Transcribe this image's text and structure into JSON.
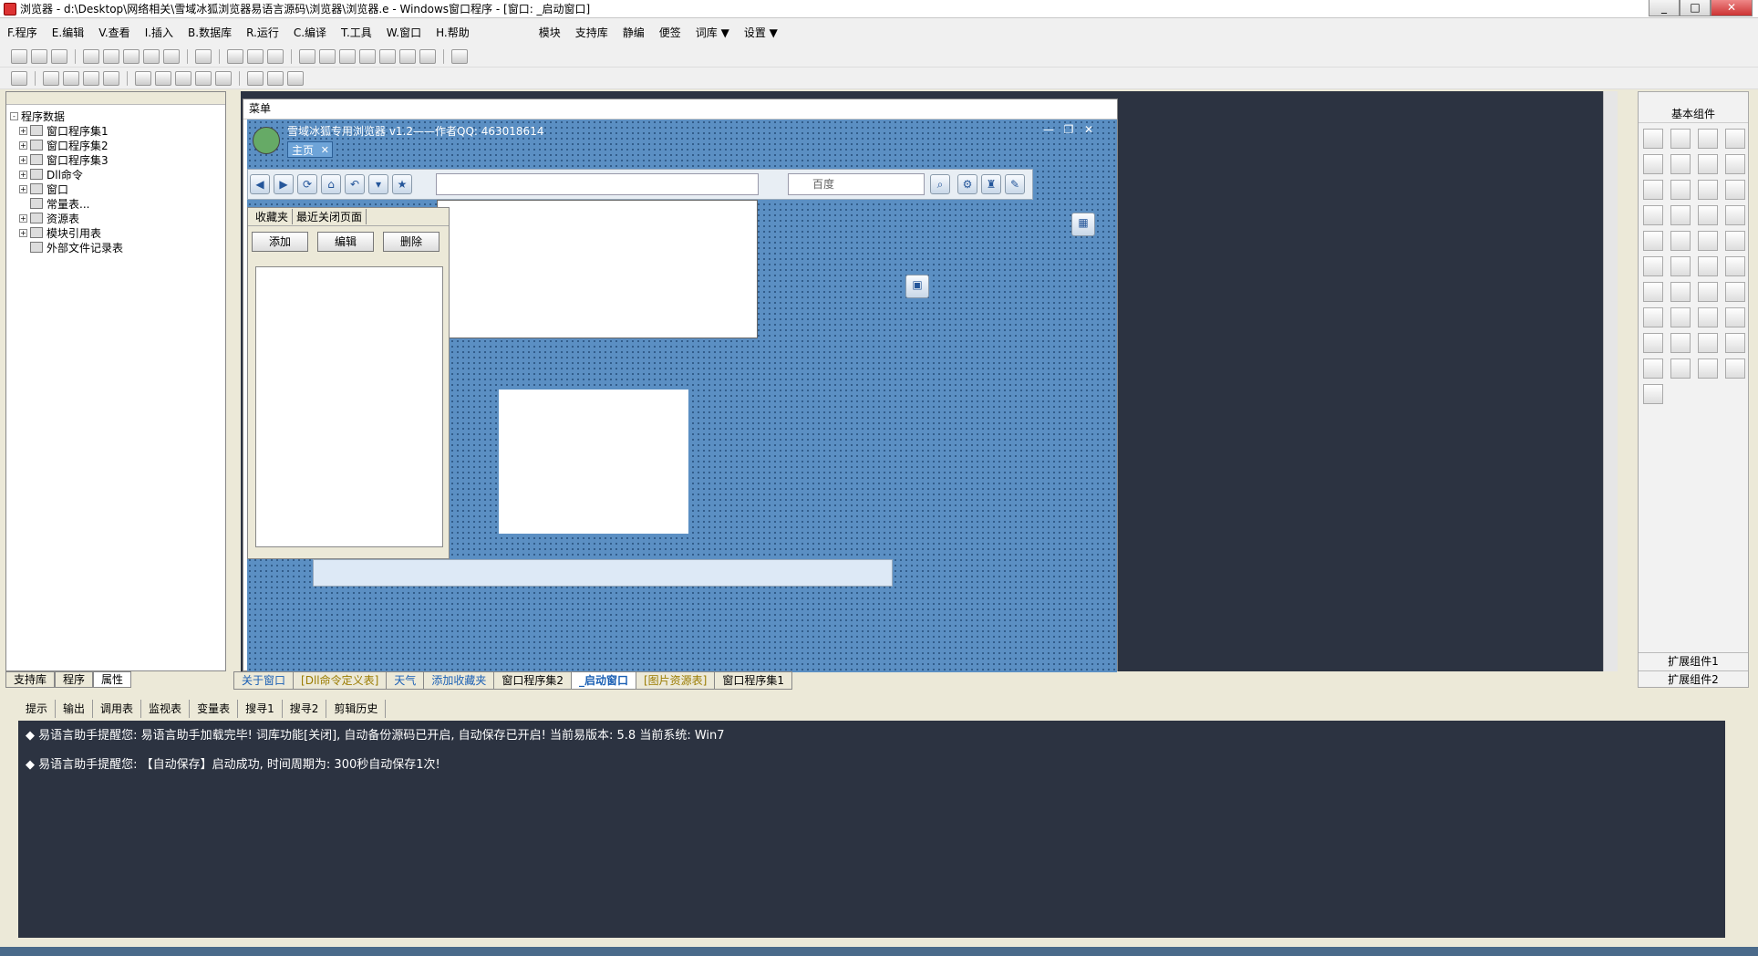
{
  "window": {
    "title": "浏览器 - d:\\Desktop\\网络相关\\雪域冰狐浏览器易语言源码\\浏览器\\浏览器.e - Windows窗口程序 - [窗口: _启动窗口]",
    "min": "_",
    "max": "□",
    "close": "✕"
  },
  "menu": {
    "items": [
      "F.程序",
      "E.编辑",
      "V.查看",
      "I.插入",
      "B.数据库",
      "R.运行",
      "C.编译",
      "T.工具",
      "W.窗口",
      "H.帮助"
    ],
    "extra": [
      "模块",
      "支持库",
      "静编",
      "便签",
      "词库 ▼",
      "设置 ▼"
    ]
  },
  "tree": {
    "root": "程序数据",
    "items": [
      "窗口程序集1",
      "窗口程序集2",
      "窗口程序集3",
      "Dll命令",
      "窗口",
      "常量表...",
      "资源表",
      "模块引用表",
      "外部文件记录表"
    ]
  },
  "left_tabs": [
    "支持库",
    "程序",
    "属性"
  ],
  "form": {
    "menu": "菜单",
    "caption": "雪域冰狐专用浏览器 v1.2——作者QQ: 463018614",
    "home_tab": "主页",
    "home_close": "✕",
    "search_placeholder": "百度",
    "fav_tabs": [
      "收藏夹",
      "最近关闭页面"
    ],
    "fav_buttons": [
      "添加",
      "编辑",
      "删除"
    ]
  },
  "right": {
    "title": "基本组件",
    "ext1": "扩展组件1",
    "ext2": "扩展组件2"
  },
  "doc_tabs": [
    "关于窗口",
    "[Dll命令定义表]",
    "天气",
    "添加收藏夹",
    "窗口程序集2",
    "_启动窗口",
    "[图片资源表]",
    "窗口程序集1"
  ],
  "output_tabs": [
    "提示",
    "输出",
    "调用表",
    "监视表",
    "变量表",
    "搜寻1",
    "搜寻2",
    "剪辑历史"
  ],
  "output_lines": [
    "易语言助手提醒您:   易语言助手加载完毕!  词库功能[关闭], 自动备份源码已开启, 自动保存已开启!  当前易版本: 5.8   当前系统: Win7",
    "易语言助手提醒您: 【自动保存】启动成功, 时间周期为: 300秒自动保存1次!"
  ]
}
